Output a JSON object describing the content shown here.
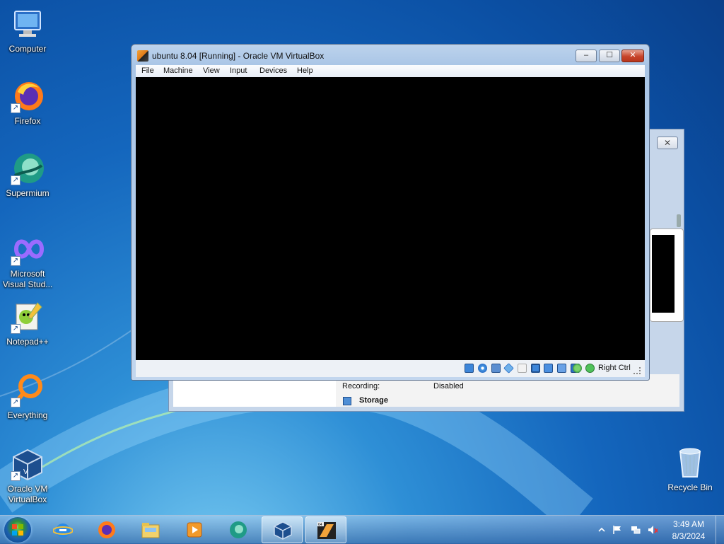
{
  "desktop": {
    "icons": [
      {
        "label": "Computer",
        "icon": "computer-icon",
        "shortcut": false
      },
      {
        "label": "Firefox",
        "icon": "firefox-icon",
        "shortcut": true
      },
      {
        "label": "Supermium",
        "icon": "supermium-icon",
        "shortcut": true
      },
      {
        "label": "Microsoft Visual Stud...",
        "icon": "visual-studio-icon",
        "shortcut": true
      },
      {
        "label": "Notepad++",
        "icon": "notepadpp-icon",
        "shortcut": true
      },
      {
        "label": "Everything",
        "icon": "everything-icon",
        "shortcut": true
      },
      {
        "label": "Oracle VM VirtualBox",
        "icon": "virtualbox-icon",
        "shortcut": true
      }
    ],
    "recycle_bin": {
      "label": "Recycle Bin",
      "icon": "recycle-bin-icon"
    }
  },
  "vm_window": {
    "title": "ubuntu 8.04 [Running] - Oracle VM VirtualBox",
    "menu": [
      "File",
      "Machine",
      "View",
      "Input",
      "Devices",
      "Help"
    ],
    "host_key_label": "Right Ctrl",
    "status_icons": [
      "hard-disk-icon",
      "optical-drive-icon",
      "audio-icon",
      "network-icon",
      "usb-icon",
      "shared-folders-icon",
      "display-icon",
      "video-capture-icon",
      "cpu-icon",
      "mouse-integration-icon",
      "keyboard-capture-icon"
    ],
    "controls": {
      "minimize": "–",
      "maximize": "☐",
      "close": "✕"
    }
  },
  "manager_window": {
    "close": "✕",
    "recording_label": "Recording:",
    "recording_value": "Disabled",
    "storage_label": "Storage"
  },
  "taskbar": {
    "pinned": [
      "internet-explorer-icon",
      "firefox-icon",
      "explorer-icon",
      "media-player-icon",
      "supermium-icon",
      "virtualbox-manager-icon",
      "virtualbox-vm-icon"
    ],
    "active_index": [
      5,
      6
    ],
    "clock_time": "3:49 AM",
    "clock_date": "8/3/2024",
    "tray": [
      "show-hidden-icons",
      "action-center-flag-icon",
      "network-icon",
      "volume-muted-icon"
    ]
  }
}
